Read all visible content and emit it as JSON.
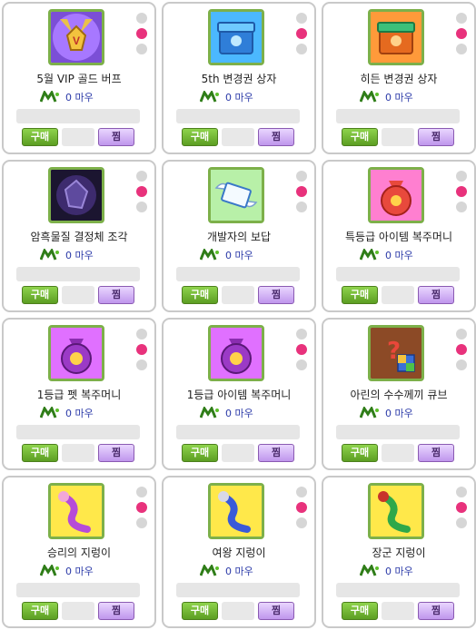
{
  "items": [
    {
      "name": "5월 VIP 골드 버프",
      "price": "0 마우",
      "buy_label": "구매",
      "wish_label": "찜",
      "icon": "vip-medal-icon"
    },
    {
      "name": "5th 변경권 상자",
      "price": "0 마우",
      "buy_label": "구매",
      "wish_label": "찜",
      "icon": "blue-box-icon"
    },
    {
      "name": "히든 변경권 상자",
      "price": "0 마우",
      "buy_label": "구매",
      "wish_label": "찜",
      "icon": "orange-box-icon"
    },
    {
      "name": "암흑물질 결정체 조각",
      "price": "0 마우",
      "buy_label": "구매",
      "wish_label": "찜",
      "icon": "dark-crystal-icon"
    },
    {
      "name": "개발자의 보답",
      "price": "0 마우",
      "buy_label": "구매",
      "wish_label": "찜",
      "icon": "winged-letter-icon"
    },
    {
      "name": "특등급 아이템 복주머니",
      "price": "0 마우",
      "buy_label": "구매",
      "wish_label": "찜",
      "icon": "lucky-pouch-special-icon"
    },
    {
      "name": "1등급 펫 복주머니",
      "price": "0 마우",
      "buy_label": "구매",
      "wish_label": "찜",
      "icon": "pet-pouch-icon"
    },
    {
      "name": "1등급 아이템 복주머니",
      "price": "0 마우",
      "buy_label": "구매",
      "wish_label": "찜",
      "icon": "item-pouch-icon"
    },
    {
      "name": "아린의 수수께끼 큐브",
      "price": "0 마우",
      "buy_label": "구매",
      "wish_label": "찜",
      "icon": "mystery-cube-icon"
    },
    {
      "name": "승리의 지렁이",
      "price": "0 마우",
      "buy_label": "구매",
      "wish_label": "찜",
      "icon": "victory-worm-icon"
    },
    {
      "name": "여왕 지렁이",
      "price": "0 마우",
      "buy_label": "구매",
      "wish_label": "찜",
      "icon": "queen-worm-icon"
    },
    {
      "name": "장군 지렁이",
      "price": "0 마우",
      "buy_label": "구매",
      "wish_label": "찜",
      "icon": "general-worm-icon"
    }
  ],
  "colors": {
    "active_dot": "#e8327c",
    "inactive_dot": "#d6d6d6",
    "buy_green": "#6fb52f",
    "wish_purple": "#c8a0f0",
    "frame_green": "#7db04a",
    "price_blue": "#2b3aa8"
  }
}
